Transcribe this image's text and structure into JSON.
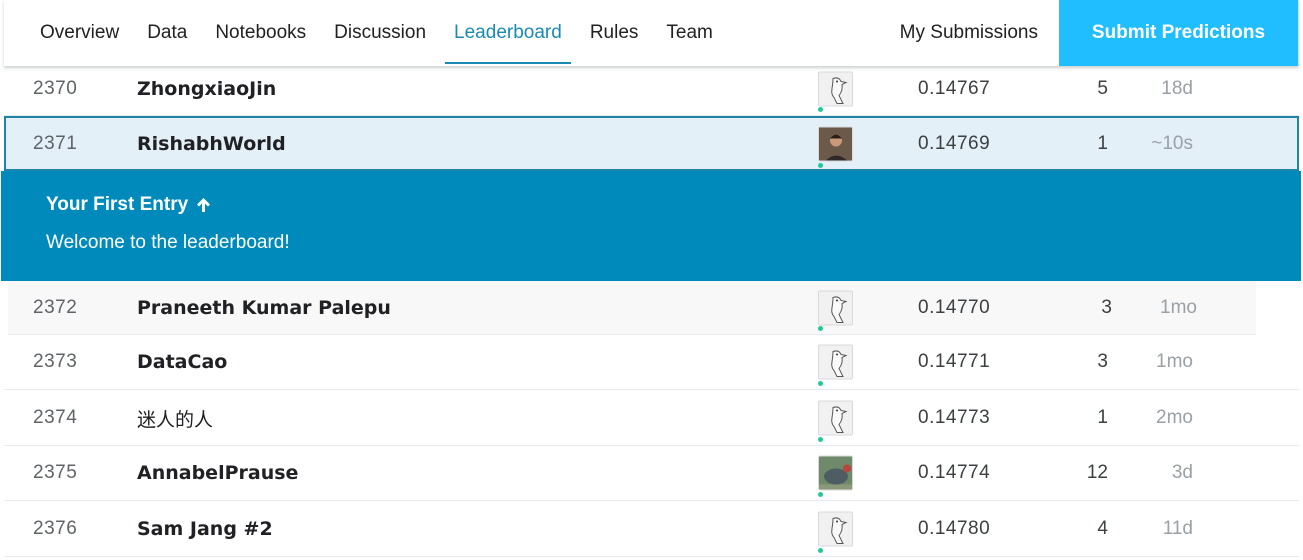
{
  "nav": {
    "tabs": [
      {
        "label": "Overview",
        "active": false
      },
      {
        "label": "Data",
        "active": false
      },
      {
        "label": "Notebooks",
        "active": false
      },
      {
        "label": "Discussion",
        "active": false
      },
      {
        "label": "Leaderboard",
        "active": true
      },
      {
        "label": "Rules",
        "active": false
      },
      {
        "label": "Team",
        "active": false
      }
    ],
    "my_submissions": "My Submissions",
    "submit_predictions": "Submit Predictions"
  },
  "banner": {
    "title": "Your First Entry",
    "title_icon": "arrow-up-icon",
    "message": "Welcome to the leaderboard!"
  },
  "rows": [
    {
      "rank": "2370",
      "team": "ZhongxiaoJin",
      "avatar": "goose-default-avatar",
      "score": "0.14767",
      "entries": "5",
      "last": "18d"
    },
    {
      "rank": "2371",
      "team": "RishabhWorld",
      "avatar": "user-photo-avatar",
      "score": "0.14769",
      "entries": "1",
      "last": "~10s"
    },
    {
      "rank": "2372",
      "team": "Praneeth Kumar Palepu",
      "avatar": "goose-default-avatar",
      "score": "0.14770",
      "entries": "3",
      "last": "1mo"
    },
    {
      "rank": "2373",
      "team": "DataCao",
      "avatar": "goose-default-avatar",
      "score": "0.14771",
      "entries": "3",
      "last": "1mo"
    },
    {
      "rank": "2374",
      "team": "迷人的人",
      "avatar": "goose-default-avatar",
      "score": "0.14773",
      "entries": "1",
      "last": "2mo"
    },
    {
      "rank": "2375",
      "team": "AnnabelPrause",
      "avatar": "bird-photo-avatar",
      "score": "0.14774",
      "entries": "12",
      "last": "3d"
    },
    {
      "rank": "2376",
      "team": "Sam Jang #2",
      "avatar": "goose-default-avatar",
      "score": "0.14780",
      "entries": "4",
      "last": "11d"
    }
  ],
  "colors": {
    "accent": "#1a8ab5",
    "submit_button": "#20beff",
    "banner": "#008abc",
    "self_row_bg": "#e3f0f8",
    "tier_dot": "#20c997"
  }
}
